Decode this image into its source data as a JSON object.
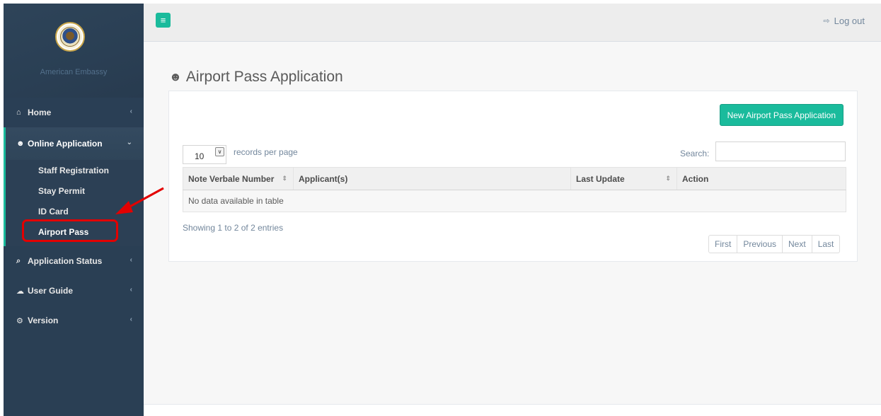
{
  "sidebar": {
    "brand_name": "American Embassy",
    "items": [
      {
        "label": "Home",
        "icon": "home-icon",
        "chevron": "‹"
      },
      {
        "label": "Online Application",
        "icon": "user-icon",
        "chevron": "⌄",
        "children": [
          "Staff Registration",
          "Stay Permit",
          "ID Card",
          "Airport Pass"
        ]
      },
      {
        "label": "Application Status",
        "icon": "search-icon",
        "chevron": "‹"
      },
      {
        "label": "User Guide",
        "icon": "cloud-icon",
        "chevron": "‹"
      },
      {
        "label": "Version",
        "icon": "gears-icon",
        "chevron": "‹"
      }
    ],
    "active_child": "Airport Pass"
  },
  "topbar": {
    "menu_icon": "hamburger-icon",
    "logout_label": "Log out",
    "logout_icon": "sign-out-icon"
  },
  "main": {
    "title": "Airport Pass Application",
    "title_icon": "user-icon",
    "new_button": "New Airport Pass Application",
    "length_value": "10",
    "length_label": "records per page",
    "search_label": "Search:",
    "search_value": "",
    "table": {
      "columns": [
        "Note Verbale Number",
        "Applicant(s)",
        "Last Update",
        "Action"
      ],
      "empty_message": "No data available in table"
    },
    "info": "Showing 1 to 2 of 2 entries",
    "pagination": [
      "First",
      "Previous",
      "Next",
      "Last"
    ]
  },
  "colors": {
    "sidebar_bg": "#2a3f54",
    "accent": "#1abb9c",
    "annotation_red": "#e30000"
  }
}
